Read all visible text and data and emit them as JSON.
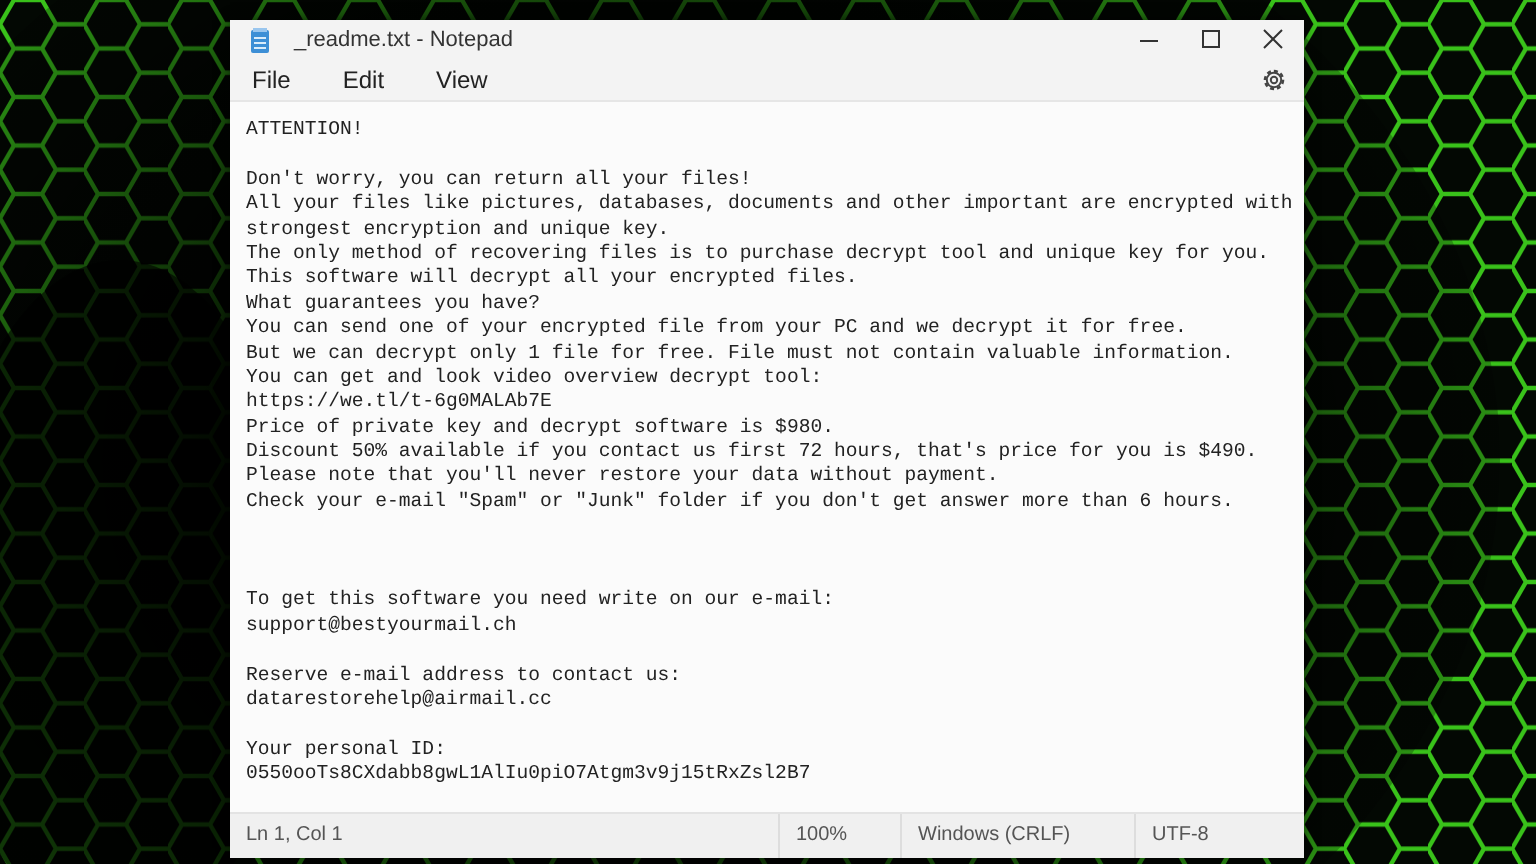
{
  "window": {
    "title": "_readme.txt - Notepad"
  },
  "menu": [
    "File",
    "Edit",
    "View"
  ],
  "document": {
    "paragraphs": [
      {
        "kind": "block",
        "lines": [
          "ATTENTION!"
        ]
      },
      {
        "kind": "body",
        "lines": [
          "Don't worry, you can return all your files!",
          "All your files like pictures, databases, documents and other important are encrypted with",
          "strongest encryption and unique key.",
          "The only method of recovering files is to purchase decrypt tool and unique key for you.",
          "This software will decrypt all your encrypted files.",
          "What guarantees you have?",
          "You can send one of your encrypted file from your PC and we decrypt it for free.",
          "But we can decrypt only 1 file for free. File must not contain valuable information.",
          "You can get and look video overview decrypt tool:",
          "https://we.tl/t-6g0MALAb7E",
          "Price of private key and decrypt software is $980.",
          "Discount 50% available if you contact us first 72 hours, that's price for you is $490.",
          "Please note that you'll never restore your data without payment.",
          "Check your e-mail \"Spam\" or \"Junk\" folder if you don't get answer more than 6 hours."
        ]
      },
      {
        "kind": "block",
        "lines": [
          "To get this software you need write on our e-mail:",
          "support@bestyourmail.ch"
        ]
      },
      {
        "kind": "block",
        "lines": [
          "Reserve e-mail address to contact us:",
          "datarestorehelp@airmail.cc"
        ]
      },
      {
        "kind": "block",
        "lines": [
          "Your personal ID:",
          "0550ooTs8CXdabb8gwL1AlIu0piO7Atgm3v9j15tRxZsl2B7"
        ]
      }
    ]
  },
  "status_bar": {
    "position": "Ln 1, Col 1",
    "zoom": "100%",
    "line_ending": "Windows (CRLF)",
    "encoding": "UTF-8"
  }
}
